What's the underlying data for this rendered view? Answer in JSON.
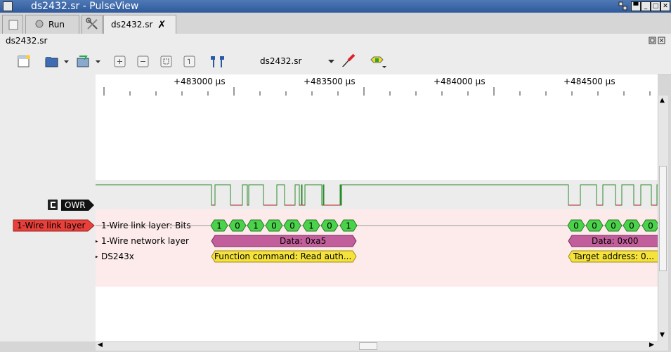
{
  "window": {
    "title": "ds2432.sr - PulseView"
  },
  "tabs": [
    {
      "label": "Run"
    },
    {
      "label": "ds2432.sr"
    }
  ],
  "session": {
    "name": "ds2432.sr"
  },
  "toolbar": {
    "device_label": "ds2432.sr"
  },
  "ruler": {
    "ticks": [
      "+483000 µs",
      "+483500 µs",
      "+484000 µs",
      "+484500 µs"
    ]
  },
  "channels": {
    "logic": {
      "name": "OWR",
      "color": "#2a8a2a"
    },
    "decoder": {
      "name": "1-Wire link layer",
      "color": "#e8403a"
    }
  },
  "rows": [
    {
      "label": "1-Wire link layer: Bits"
    },
    {
      "label": "1-Wire network layer"
    },
    {
      "label": "DS243x"
    }
  ],
  "bits": {
    "group1": [
      "1",
      "0",
      "1",
      "0",
      "0",
      "1",
      "0",
      "1"
    ],
    "group2": [
      "0",
      "0",
      "0",
      "0",
      "0"
    ],
    "color": "#4ad24a"
  },
  "network": {
    "ann1": "Data: 0xa5",
    "ann2": "Data: 0x00",
    "color": "#c35e9c"
  },
  "ds243x": {
    "ann1": "Function command: Read auth...",
    "ann2": "Target address: 0...",
    "color": "#f5e33c"
  }
}
